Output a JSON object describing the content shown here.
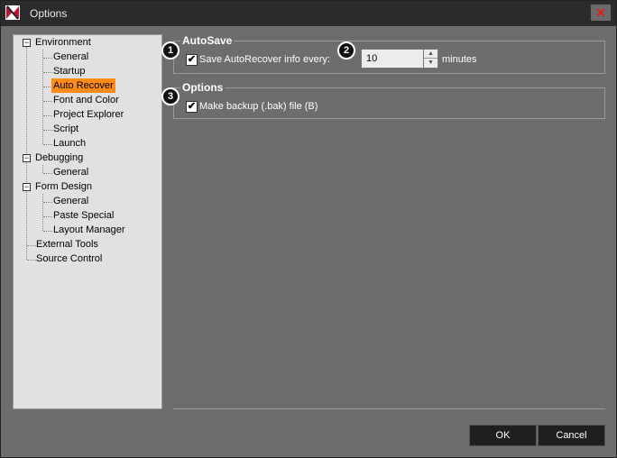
{
  "window": {
    "title": "Options"
  },
  "tree": {
    "environment": {
      "label": "Environment",
      "expander": "−"
    },
    "environment_children": [
      "General",
      "Startup",
      "Auto Recover",
      "Font and Color",
      "Project Explorer",
      "Script",
      "Launch"
    ],
    "debugging": {
      "label": "Debugging",
      "expander": "−"
    },
    "debugging_children": [
      "General"
    ],
    "form_design": {
      "label": "Form Design",
      "expander": "−"
    },
    "form_design_children": [
      "General",
      "Paste Special",
      "Layout Manager"
    ],
    "external_tools": "External Tools",
    "source_control": "Source Control",
    "selected": "Auto Recover"
  },
  "autosave": {
    "title": "AutoSave",
    "checkbox_label": "Save AutoRecover info every:",
    "checked_glyph": "✔",
    "interval_value": "10",
    "units": "minutes"
  },
  "options": {
    "title": "Options",
    "backup_label": "Make backup (.bak) file (B)",
    "checked_glyph": "✔"
  },
  "badges": [
    "1",
    "2",
    "3"
  ],
  "buttons": {
    "ok": "OK",
    "cancel": "Cancel"
  },
  "colors": {
    "selection": "#ff8c1a",
    "close": "#e0201a",
    "dialog_bg": "#6d6d6d",
    "tree_bg": "#e1e1e1"
  }
}
